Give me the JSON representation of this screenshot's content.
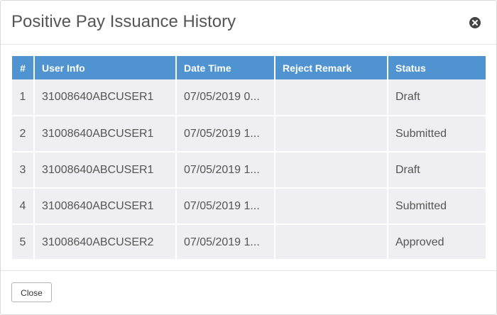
{
  "dialog": {
    "title": "Positive Pay Issuance History",
    "close_icon": "close-circle-icon",
    "close_button_label": "Close"
  },
  "table": {
    "columns": [
      "#",
      "User Info",
      "Date Time",
      "Reject Remark",
      "Status"
    ],
    "rows": [
      {
        "num": "1",
        "user": "31008640ABCUSER1",
        "datetime": "07/05/2019 0...",
        "remark": "",
        "status": "Draft"
      },
      {
        "num": "2",
        "user": "31008640ABCUSER1",
        "datetime": "07/05/2019 1...",
        "remark": "",
        "status": "Submitted"
      },
      {
        "num": "3",
        "user": "31008640ABCUSER1",
        "datetime": "07/05/2019 1...",
        "remark": "",
        "status": "Draft"
      },
      {
        "num": "4",
        "user": "31008640ABCUSER1",
        "datetime": "07/05/2019 1...",
        "remark": "",
        "status": "Submitted"
      },
      {
        "num": "5",
        "user": "31008640ABCUSER2",
        "datetime": "07/05/2019 1...",
        "remark": "",
        "status": "Approved"
      }
    ]
  },
  "colors": {
    "header_bg": "#4f93d0",
    "row_bg": "#efeff3",
    "title_text": "#555555"
  }
}
